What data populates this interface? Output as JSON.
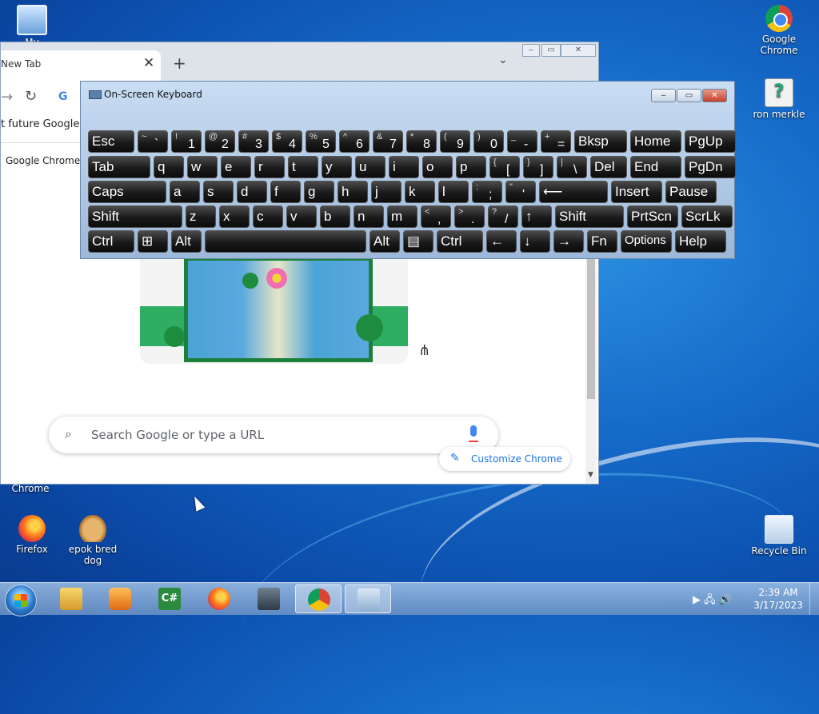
{
  "desktop": {
    "icons": [
      {
        "label": "My Computer"
      },
      {
        "label": "Google Chrome"
      },
      {
        "label": "ron merkle"
      },
      {
        "label": "Chrome"
      },
      {
        "label": "Firefox"
      },
      {
        "label": "epok bred dog"
      },
      {
        "label": "Recycle Bin"
      }
    ]
  },
  "chrome": {
    "tab_title": "New Tab",
    "tab_close": "✕",
    "new_tab": "+",
    "tab_search": "⌄",
    "forward": "→",
    "reload": "↻",
    "g": "G",
    "omnibox_suggestion": "t future Google C",
    "bookmark": "Google Chrome",
    "search_placeholder": "Search Google or type a URL",
    "customize_label": "Customize Chrome",
    "window_controls": {
      "minimize": "‒",
      "restore": "▭",
      "close": "✕"
    }
  },
  "osk": {
    "title": "On-Screen Keyboard",
    "controls": {
      "minimize": "‒",
      "restore": "▭",
      "close": "✕"
    },
    "rows": [
      [
        {
          "main": "Esc",
          "w": 58
        },
        {
          "shift": "~",
          "main": "`",
          "w": 38
        },
        {
          "shift": "!",
          "main": "1",
          "w": 38
        },
        {
          "shift": "@",
          "main": "2",
          "w": 38
        },
        {
          "shift": "#",
          "main": "3",
          "w": 38
        },
        {
          "shift": "$",
          "main": "4",
          "w": 38
        },
        {
          "shift": "%",
          "main": "5",
          "w": 38
        },
        {
          "shift": "^",
          "main": "6",
          "w": 38
        },
        {
          "shift": "&",
          "main": "7",
          "w": 38
        },
        {
          "shift": "*",
          "main": "8",
          "w": 38
        },
        {
          "shift": "(",
          "main": "9",
          "w": 38
        },
        {
          "shift": ")",
          "main": "0",
          "w": 38
        },
        {
          "shift": "_",
          "main": "-",
          "w": 38
        },
        {
          "shift": "+",
          "main": "=",
          "w": 38
        },
        {
          "main": "Bksp",
          "w": 66
        },
        {
          "main": "Home",
          "w": 64
        },
        {
          "main": "PgUp",
          "w": 64
        }
      ],
      [
        {
          "main": "Tab",
          "w": 78
        },
        {
          "main": "q",
          "w": 38
        },
        {
          "main": "w",
          "w": 38
        },
        {
          "main": "e",
          "w": 38
        },
        {
          "main": "r",
          "w": 38
        },
        {
          "main": "t",
          "w": 38
        },
        {
          "main": "y",
          "w": 38
        },
        {
          "main": "u",
          "w": 38
        },
        {
          "main": "i",
          "w": 38
        },
        {
          "main": "o",
          "w": 38
        },
        {
          "main": "p",
          "w": 38
        },
        {
          "shift": "{",
          "main": "[",
          "w": 38
        },
        {
          "shift": "}",
          "main": "]",
          "w": 38
        },
        {
          "shift": "|",
          "main": "\\",
          "w": 38
        },
        {
          "main": "Del",
          "w": 46
        },
        {
          "main": "End",
          "w": 64
        },
        {
          "main": "PgDn",
          "w": 64
        }
      ],
      [
        {
          "main": "Caps",
          "w": 98
        },
        {
          "main": "a",
          "w": 38
        },
        {
          "main": "s",
          "w": 38
        },
        {
          "main": "d",
          "w": 38
        },
        {
          "main": "f",
          "w": 38
        },
        {
          "main": "g",
          "w": 38
        },
        {
          "main": "h",
          "w": 38
        },
        {
          "main": "j",
          "w": 38
        },
        {
          "main": "k",
          "w": 38
        },
        {
          "main": "l",
          "w": 38
        },
        {
          "shift": ":",
          "main": ";",
          "w": 38
        },
        {
          "shift": "\"",
          "main": "'",
          "w": 38
        },
        {
          "main": "⟵",
          "w": 86
        },
        {
          "main": "Insert",
          "w": 64
        },
        {
          "main": "Pause",
          "w": 64
        }
      ],
      [
        {
          "main": "Shift",
          "w": 118
        },
        {
          "main": "z",
          "w": 38
        },
        {
          "main": "x",
          "w": 38
        },
        {
          "main": "c",
          "w": 38
        },
        {
          "main": "v",
          "w": 38
        },
        {
          "main": "b",
          "w": 38
        },
        {
          "main": "n",
          "w": 38
        },
        {
          "main": "m",
          "w": 38
        },
        {
          "shift": "<",
          "main": ",",
          "w": 38
        },
        {
          "shift": ">",
          "main": ".",
          "w": 38
        },
        {
          "shift": "?",
          "main": "/",
          "w": 38
        },
        {
          "main": "↑",
          "w": 38
        },
        {
          "main": "Shift",
          "w": 86
        },
        {
          "main": "PrtScn",
          "w": 64
        },
        {
          "main": "ScrLk",
          "w": 64
        }
      ],
      [
        {
          "main": "Ctrl",
          "w": 58
        },
        {
          "main": "⊞",
          "w": 38
        },
        {
          "main": "Alt",
          "w": 38
        },
        {
          "main": "",
          "w": 202
        },
        {
          "main": "Alt",
          "w": 38
        },
        {
          "main": "▤",
          "w": 38
        },
        {
          "main": "Ctrl",
          "w": 58
        },
        {
          "main": "←",
          "w": 38
        },
        {
          "main": "↓",
          "w": 38
        },
        {
          "main": "→",
          "w": 38
        },
        {
          "main": "Fn",
          "w": 38
        },
        {
          "main": "Options",
          "w": 64
        },
        {
          "main": "Help",
          "w": 64
        }
      ]
    ]
  },
  "taskbar": {
    "items": [
      "Windows Explorer",
      "Windows Media Player",
      "C# Project",
      "Firefox",
      "Task Monitor",
      "Google Chrome",
      "On-Screen Keyboard"
    ],
    "tray": "▶ 🖧 🔊",
    "time": "2:39 AM",
    "date": "3/17/2023"
  }
}
